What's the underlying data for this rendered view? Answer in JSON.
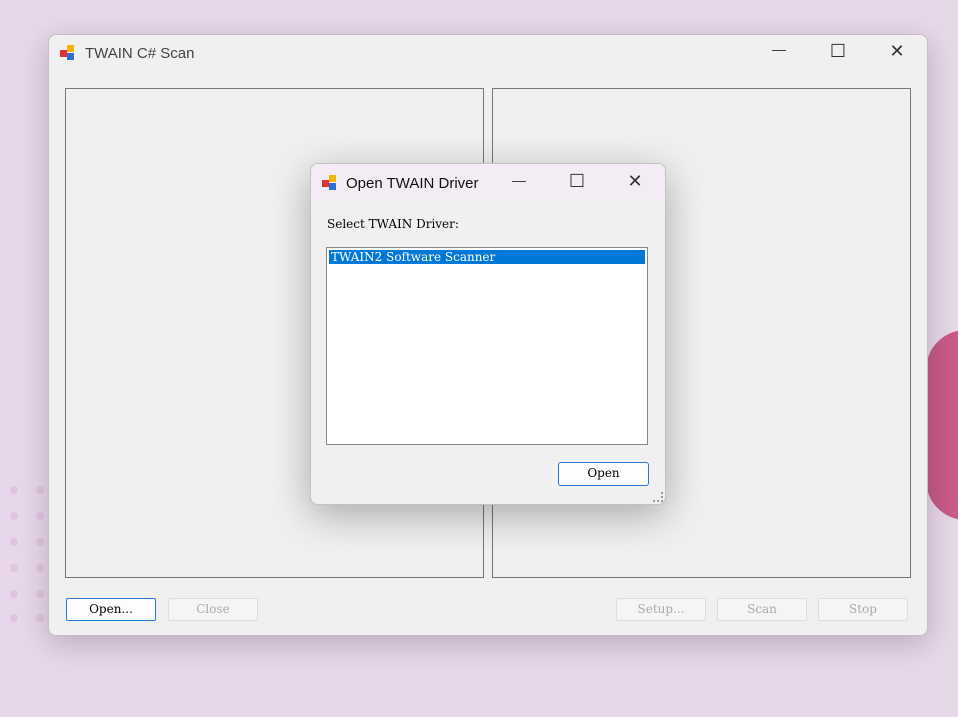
{
  "main_window": {
    "title": "TWAIN C# Scan",
    "buttons": {
      "open": "Open...",
      "close": "Close",
      "setup": "Setup...",
      "scan": "Scan",
      "stop": "Stop"
    }
  },
  "dialog": {
    "title": "Open TWAIN Driver",
    "label": "Select TWAIN Driver:",
    "items": [
      "TWAIN2 Software Scanner"
    ],
    "open": "Open"
  },
  "window_controls": {
    "minimize": "—",
    "maximize": "☐",
    "close": "✕"
  }
}
